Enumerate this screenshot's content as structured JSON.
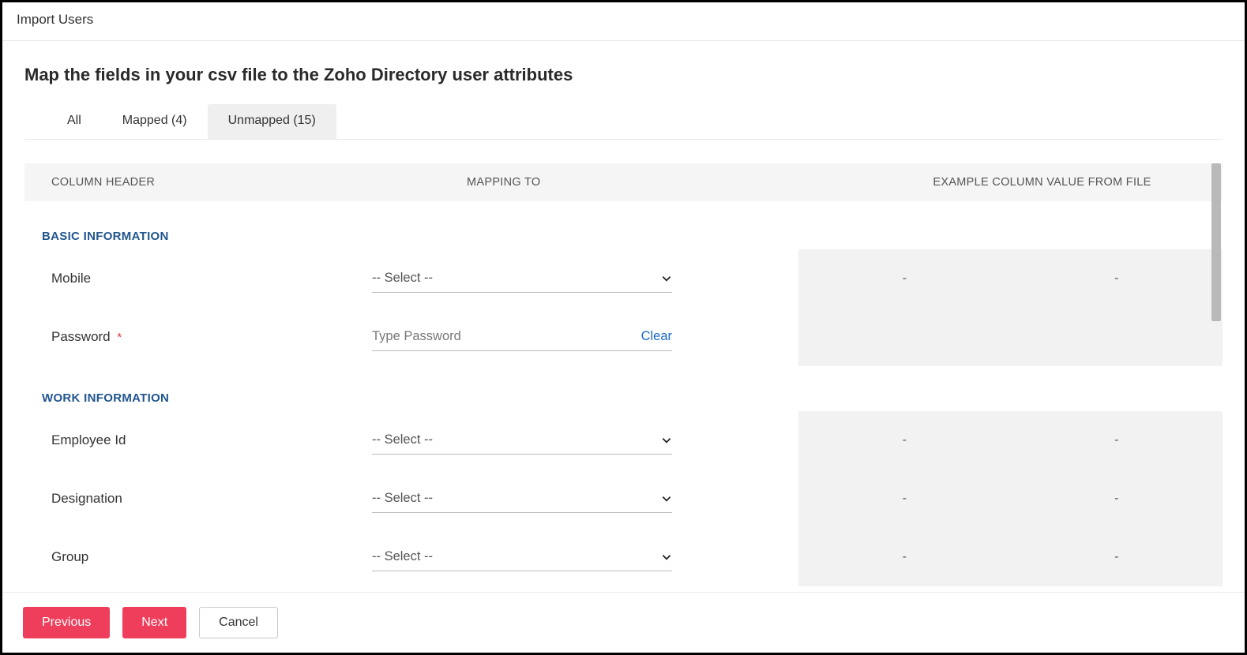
{
  "window": {
    "title": "Import Users"
  },
  "instruction": "Map the fields in your csv file to the Zoho Directory user attributes",
  "tabs": {
    "all": "All",
    "mapped": "Mapped (4)",
    "unmapped": "Unmapped (15)",
    "active": "unmapped"
  },
  "header": {
    "col_a": "COLUMN HEADER",
    "col_b": "MAPPING TO",
    "col_c": "EXAMPLE COLUMN VALUE FROM FILE"
  },
  "sections": {
    "basic": {
      "title": "BASIC INFORMATION",
      "rows": {
        "mobile": {
          "label": "Mobile",
          "select": "-- Select --",
          "ex1": "-",
          "ex2": "-"
        },
        "password": {
          "label": "Password",
          "placeholder": "Type Password",
          "clear": "Clear"
        }
      }
    },
    "work": {
      "title": "WORK INFORMATION",
      "rows": {
        "employee_id": {
          "label": "Employee Id",
          "select": "-- Select --",
          "ex1": "-",
          "ex2": "-"
        },
        "designation": {
          "label": "Designation",
          "select": "-- Select --",
          "ex1": "-",
          "ex2": "-"
        },
        "group": {
          "label": "Group",
          "select": "-- Select --",
          "ex1": "-",
          "ex2": "-"
        }
      }
    }
  },
  "footer": {
    "previous": "Previous",
    "next": "Next",
    "cancel": "Cancel"
  }
}
